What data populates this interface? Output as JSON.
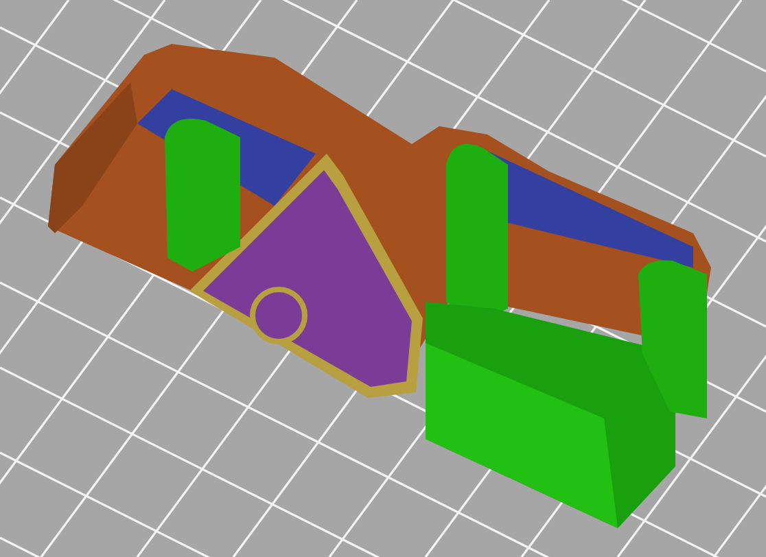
{
  "viewport": {
    "kind": "gcode-preview"
  }
}
